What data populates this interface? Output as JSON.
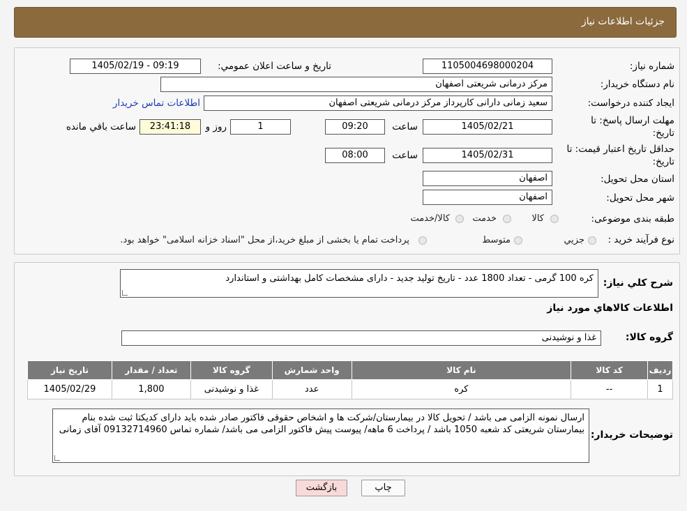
{
  "header": {
    "title": "جزئیات اطلاعات نیاز"
  },
  "form": {
    "need_number": {
      "label": "شماره نیاز:",
      "value": "1105004698000204"
    },
    "announce_datetime": {
      "label": "تاریخ و ساعت اعلان عمومي:",
      "value": "1405/02/19 - 09:19"
    },
    "buyer_org": {
      "label": "نام دستگاه خریدار:",
      "value": "مرکز درمانی شریعتی اصفهان"
    },
    "requester": {
      "label": "ایجاد کننده درخواست:",
      "value": "سعید زمانی دارانی کارپرداز مرکز درمانی شریعتی اصفهان"
    },
    "contact_link": "اطلاعات تماس خریدار",
    "reply_deadline": {
      "label_line1": "مهلت ارسال پاسخ: تا",
      "label_line2": "تاریخ:",
      "date": "1405/02/21",
      "time_label": "ساعت",
      "time": "09:20",
      "days": "1",
      "days_label": "روز و",
      "remaining": "23:41:18",
      "remaining_label": "ساعت باقي مانده"
    },
    "price_validity": {
      "label_line1": "حداقل تاریخ اعتبار قیمت: تا",
      "label_line2": "تاریخ:",
      "date": "1405/02/31",
      "time_label": "ساعت",
      "time": "08:00"
    },
    "province": {
      "label": "استان محل تحویل:",
      "value": "اصفهان"
    },
    "city": {
      "label": "شهر محل تحویل:",
      "value": "اصفهان"
    },
    "category": {
      "label": "طبقه بندی موضوعی:",
      "options": [
        "کالا",
        "خدمت",
        "کالا/خدمت"
      ]
    },
    "purchase_type": {
      "label": "نوع فرآیند خرید :",
      "options": [
        "جزیي",
        "متوسط"
      ],
      "note": "پرداخت تمام یا بخشی از مبلغ خرید،از محل \"اسناد خزانه اسلامی\" خواهد بود."
    }
  },
  "details": {
    "description_label": "شرح کلي نیاز:",
    "description": "کره 100 گرمی - تعداد 1800 عدد - تاریخ تولید جدید - دارای مشخصات کامل بهداشتی و استاندارد",
    "goods_info_title": "اطلاعات کالاهاي مورد نياز",
    "group_label": "گروه کالا:",
    "group_value": "غذا و نوشیدنی"
  },
  "table": {
    "headers": [
      "ردیف",
      "کد کالا",
      "نام کالا",
      "واحد شمارش",
      "گروه کالا",
      "تعداد / مقدار",
      "تاریخ نیاز"
    ],
    "rows": [
      [
        "1",
        "--",
        "کره",
        "عدد",
        "غذا و نوشیدنی",
        "1,800",
        "1405/02/29"
      ]
    ]
  },
  "buyer_notes": {
    "label": "توضیحات خریدار:",
    "text": "ارسال نمونه الزامی می باشد / تحویل کالا در بیمارستان/شرکت ها و اشخاص حقوقی فاکتور صادر شده باید دارای کدیکتا ثبت شده بنام بیمارستان شریعتی کد شعبه 1050 باشد / پرداخت 6 ماهه/ پیوست پیش فاکتور الزامی می باشد/ شماره تماس 09132714960 آقای زمانی"
  },
  "buttons": {
    "print": "چاپ",
    "back": "بازگشت"
  },
  "colors": {
    "header_bg": "#8b6a3e",
    "back_button_bg": "#f9d9d9",
    "timer_bg": "#fdfbd9"
  }
}
